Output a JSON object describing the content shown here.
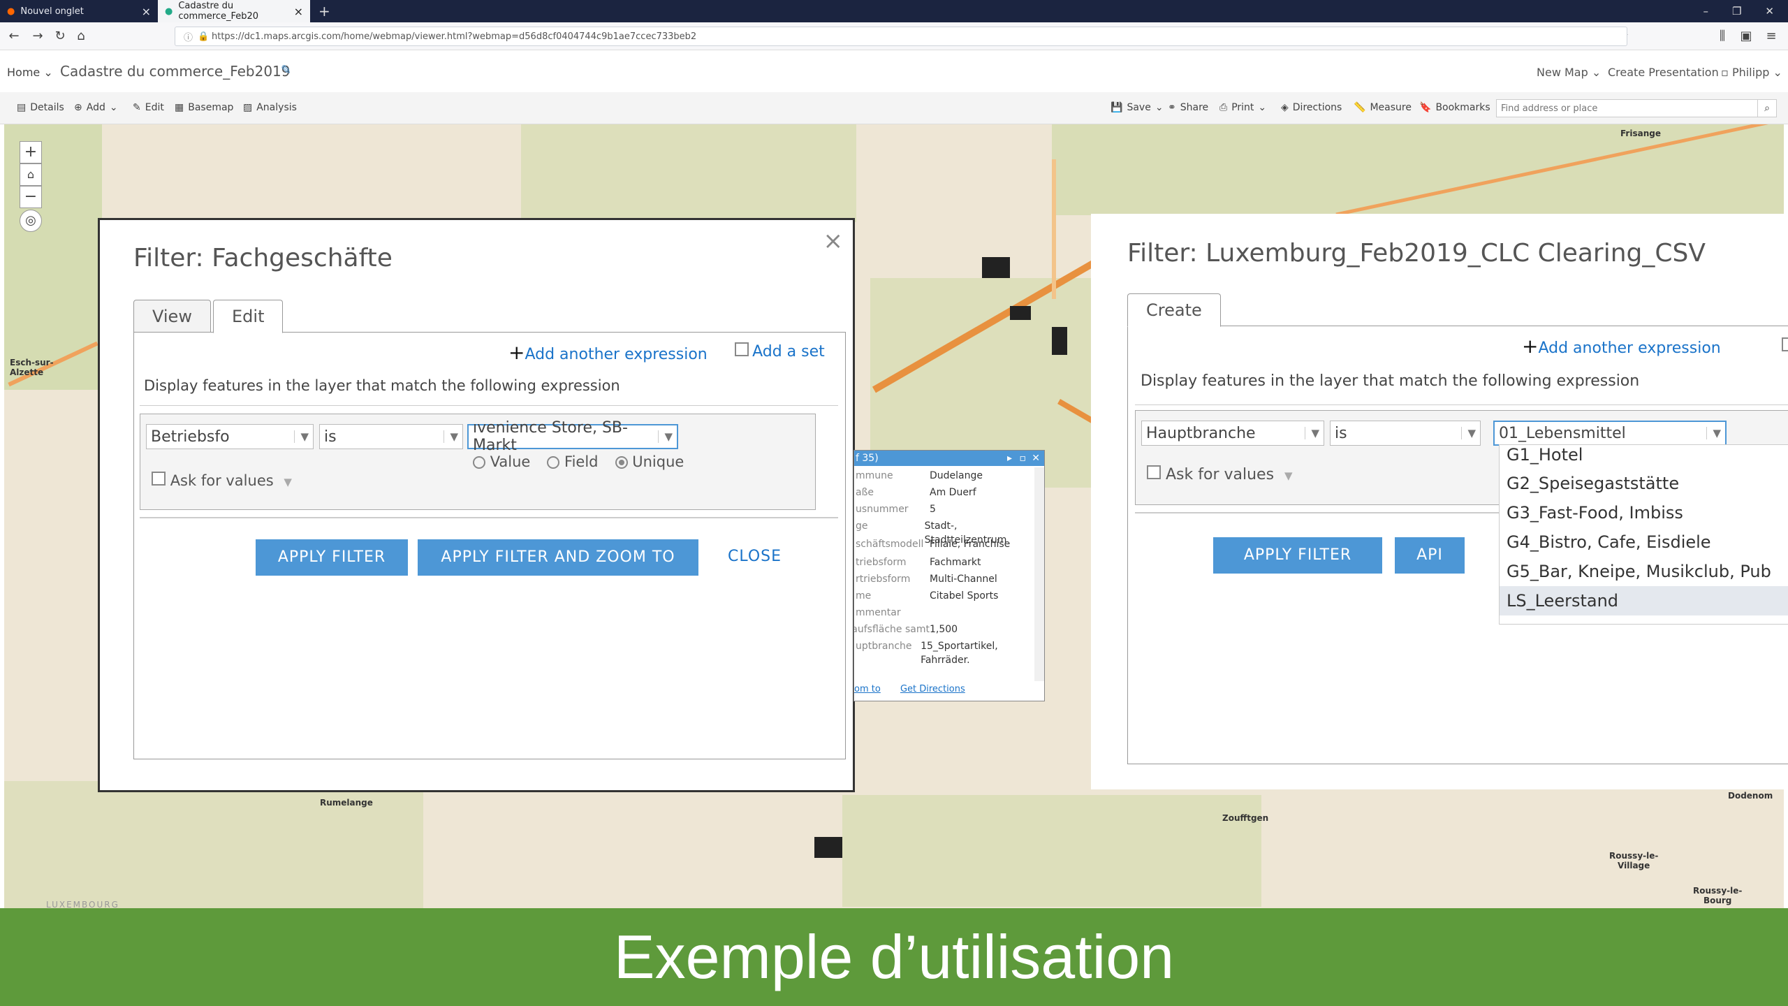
{
  "browser": {
    "tabs": [
      {
        "label": "Nouvel onglet"
      },
      {
        "label": "Cadastre du commerce_Feb20"
      }
    ],
    "url": "https://dc1.maps.arcgis.com/home/webmap/viewer.html?webmap=d56d8cf0404744c9b1ae7ccec733beb2"
  },
  "agol": {
    "home": "Home",
    "title": "Cadastre du commerce_Feb2019",
    "new_map": "New Map",
    "create_presentation": "Create Presentation",
    "user": "Philipp"
  },
  "toolbar": {
    "details": "Details",
    "add": "Add",
    "edit": "Edit",
    "basemap": "Basemap",
    "analysis": "Analysis",
    "save": "Save",
    "share": "Share",
    "print": "Print",
    "directions": "Directions",
    "measure": "Measure",
    "bookmarks": "Bookmarks",
    "search_placeholder": "Find address or place"
  },
  "map_labels": {
    "esch": "Esch-sur-\nAlzette",
    "rumelange": "Rumelange",
    "zoufftgen": "Zoufftgen",
    "roussy_village": "Roussy-le-\nVillage",
    "roussy_bourg": "Roussy-le-\nBourg",
    "dodenom": "Dodenom",
    "frisange": "Frisange",
    "luxembourg": "LUXEMBOURG"
  },
  "filter_left": {
    "title": "Filter: Fachgeschäfte",
    "tab_view": "View",
    "tab_edit": "Edit",
    "add_expression": "Add another expression",
    "add_set": "Add a set",
    "description": "Display features in the layer that match the following expression",
    "field": "Betriebsfo",
    "operator": "is",
    "value": "ıvenience Store, SB-Markt",
    "radio_value": "Value",
    "radio_field": "Field",
    "radio_unique": "Unique",
    "ask_for_values": "Ask for values",
    "apply": "APPLY FILTER",
    "apply_zoom": "APPLY FILTER AND ZOOM TO",
    "close": "CLOSE"
  },
  "filter_right": {
    "title": "Filter: Luxemburg_Feb2019_CLC Clearing_CSV",
    "tab_create": "Create",
    "add_expression": "Add another expression",
    "description": "Display features in the layer that match the following expression",
    "field": "Hauptbranche",
    "operator": "is",
    "value": "01_Lebensmittel",
    "ask_for_values": "Ask for values",
    "apply": "APPLY FILTER",
    "apply_zoom_partial": "API",
    "options": [
      "G1_Hotel",
      "G2_Speisegaststätte",
      "G3_Fast-Food, Imbiss",
      "G4_Bistro, Cafe, Eisdiele",
      "G5_Bar, Kneipe, Musikclub, Pub",
      "LS_Leerstand"
    ]
  },
  "popup": {
    "header": "f 35)",
    "rows": [
      {
        "k": "mmune",
        "v": "Dudelange"
      },
      {
        "k": "aße",
        "v": "Am Duerf"
      },
      {
        "k": "usnummer",
        "v": "5"
      },
      {
        "k": "ge",
        "v": "Stadt-, Stadtteilzentrum"
      },
      {
        "k": "schäftsmodell",
        "v": "Filiale, Franchise"
      },
      {
        "k": "triebsform",
        "v": "Fachmarkt"
      },
      {
        "k": "rtriebsform",
        "v": "Multi-Channel"
      },
      {
        "k": "me",
        "v": "Citabel Sports"
      },
      {
        "k": "mmentar",
        "v": ""
      },
      {
        "k": "rkaufsfläche samt",
        "v": "1,500"
      },
      {
        "k": "uptbranche",
        "v": "15_Sportartikel, Fahrräder."
      }
    ],
    "zoom_to": "om to",
    "get_directions": "Get Directions"
  },
  "footer": {
    "caption": "Exemple d’utilisation"
  }
}
